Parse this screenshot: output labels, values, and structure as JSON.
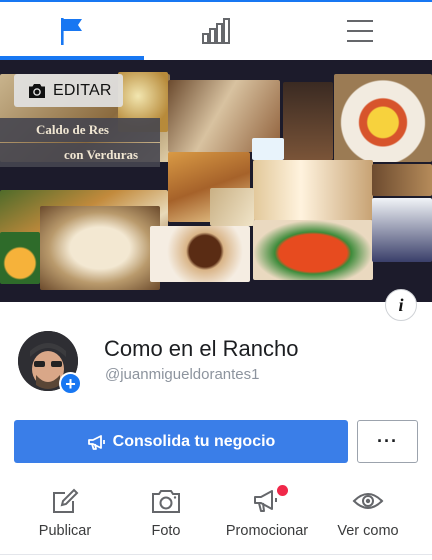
{
  "tabs": [
    {
      "name": "page",
      "icon": "flag-icon",
      "active": true
    },
    {
      "name": "insights",
      "icon": "bar-chart-icon",
      "active": false
    },
    {
      "name": "menu",
      "icon": "hamburger-menu-icon",
      "active": false
    }
  ],
  "cover": {
    "edit_label": "EDITAR",
    "edit_icon": "camera-icon",
    "caption_line1": "Caldo de Res",
    "caption_line2": "con Verduras",
    "info_icon": "info-icon"
  },
  "profile": {
    "page_name": "Como en el Rancho",
    "username": "@juanmigueldorantes1",
    "add_icon": "plus-icon"
  },
  "buttons": {
    "promote_label": "Consolida tu negocio",
    "promote_icon": "megaphone-icon",
    "more_label": "···"
  },
  "actions": [
    {
      "label": "Publicar",
      "icon": "edit-icon"
    },
    {
      "label": "Foto",
      "icon": "camera-icon"
    },
    {
      "label": "Promocionar",
      "icon": "megaphone-icon",
      "notification": true
    },
    {
      "label": "Ver como",
      "icon": "eye-icon"
    }
  ],
  "colors": {
    "accent": "#1877f2",
    "button_blue": "#3a7ee8",
    "notification_red": "#f02849",
    "icon_gray": "#65676b"
  }
}
